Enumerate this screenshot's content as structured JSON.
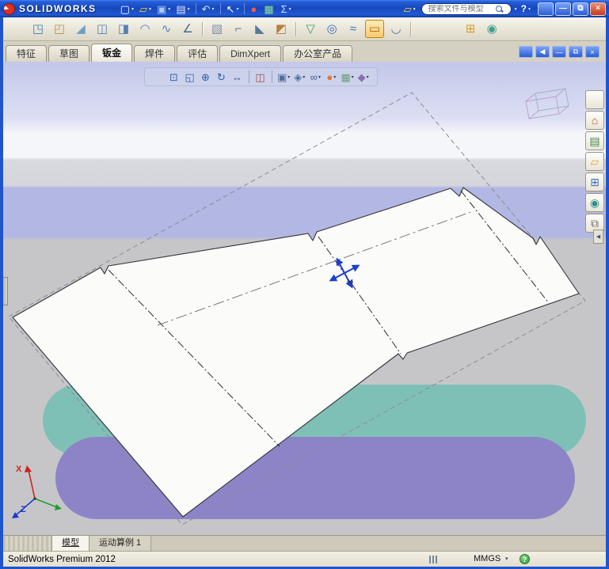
{
  "colors": {
    "frame_blue": "#1f55cc",
    "scene_teal": "#7fc0b6",
    "scene_purple": "#8d84c8",
    "highlight_orange": "#ffc96e"
  },
  "titlebar": {
    "app_name": "SOLIDWORKS",
    "search_placeholder": "搜索文件与模型",
    "search_arrow": "▾",
    "help": {
      "glyph": "?",
      "arrow": "▾"
    },
    "tools": [
      {
        "name": "new-document-button",
        "glyph": "▢",
        "color": "#ffffff",
        "arrow": "▾"
      },
      {
        "name": "open-document-button",
        "glyph": "▱",
        "color": "#ffd24a",
        "arrow": "▾"
      },
      {
        "name": "save-button",
        "glyph": "▣",
        "color": "#a8ccff",
        "arrow": "▾"
      },
      {
        "name": "print-button",
        "glyph": "▤",
        "color": "#dde6f8",
        "arrow": "▾"
      },
      {
        "sep": true
      },
      {
        "name": "undo-button",
        "glyph": "↶",
        "color": "#cfe2ff",
        "arrow": "▾"
      },
      {
        "sep": true
      },
      {
        "name": "select-button",
        "glyph": "↖",
        "color": "#ffffff",
        "arrow": "▾"
      },
      {
        "sep": true
      },
      {
        "name": "xpert-button",
        "glyph": "●",
        "color": "#ff5a4a",
        "arrow": ""
      },
      {
        "name": "measure-button",
        "glyph": "▦",
        "color": "#8fe08f",
        "arrow": ""
      },
      {
        "name": "equations-button",
        "glyph": "Σ",
        "color": "#cfe2ff",
        "arrow": "▾"
      }
    ],
    "search_tools": [
      {
        "name": "open-folder-button",
        "glyph": "▱",
        "color": "#ffd24a",
        "arrow": "▾"
      }
    ],
    "window_buttons": [
      {
        "name": "minimize-window-button",
        "glyph": "—"
      },
      {
        "name": "restore-window-button",
        "glyph": "⧉"
      },
      {
        "name": "close-window-button",
        "glyph": "×",
        "cls": "close"
      }
    ]
  },
  "sheetmetal_toolbar": [
    {
      "name": "base-flange-button",
      "glyph": "◳",
      "color": "#3f7fb8"
    },
    {
      "name": "convert-to-sheet-metal-button",
      "glyph": "◰",
      "color": "#b8913f"
    },
    {
      "name": "lofted-bend-button",
      "glyph": "◢",
      "color": "#6f9fc8"
    },
    {
      "name": "edge-flange-button",
      "glyph": "◫",
      "color": "#4f82b4"
    },
    {
      "name": "miter-flange-button",
      "glyph": "◨",
      "color": "#4f82b4"
    },
    {
      "name": "hem-button",
      "glyph": "◠",
      "color": "#4f82b4"
    },
    {
      "name": "jog-button",
      "glyph": "∿",
      "color": "#4f82b4"
    },
    {
      "name": "sketched-bend-button",
      "glyph": "∠",
      "color": "#48688c"
    },
    {
      "sep": true
    },
    {
      "name": "cross-break-button",
      "glyph": "▧",
      "color": "#7f8fa8"
    },
    {
      "name": "closed-corner-button",
      "glyph": "⌐",
      "color": "#56789a"
    },
    {
      "name": "welded-corner-button",
      "glyph": "◣",
      "color": "#56789a"
    },
    {
      "name": "forming-tool-button",
      "glyph": "◩",
      "color": "#b87f40"
    },
    {
      "sep": true
    },
    {
      "name": "extruded-cut-button",
      "glyph": "▽",
      "color": "#3f9f5f"
    },
    {
      "name": "simple-hole-button",
      "glyph": "◎",
      "color": "#3f6fbf"
    },
    {
      "name": "vent-button",
      "glyph": "≈",
      "color": "#3f6fbf"
    },
    {
      "name": "flatten-button",
      "glyph": "▭",
      "color": "#a06a10",
      "active": true
    },
    {
      "name": "no-bends-button",
      "glyph": "◡",
      "color": "#56789a"
    },
    {
      "sep": true,
      "gap": 60
    },
    {
      "name": "photoview-button",
      "glyph": "⊞",
      "color": "#d0a030"
    },
    {
      "name": "appearances-button",
      "glyph": "◉",
      "color": "#3f9f8f"
    }
  ],
  "command_tabs": [
    {
      "name": "tab-features",
      "label": "特征"
    },
    {
      "name": "tab-sketch",
      "label": "草图"
    },
    {
      "name": "tab-sheet-metal",
      "label": "钣金",
      "active": true
    },
    {
      "name": "tab-weldments",
      "label": "焊件"
    },
    {
      "name": "tab-evaluate",
      "label": "评估"
    },
    {
      "name": "tab-dimxpert",
      "label": "DimXpert"
    },
    {
      "name": "tab-office-products",
      "label": "办公室产品"
    }
  ],
  "tab_window_buttons": [
    {
      "name": "expand-featuremanager-button",
      "glyph": "◀"
    },
    {
      "name": "minimize-document-button",
      "glyph": "—"
    },
    {
      "name": "restore-document-button",
      "glyph": "⧉"
    },
    {
      "name": "close-document-button",
      "glyph": "×"
    }
  ],
  "view_toolbar": [
    {
      "name": "zoom-fit-button",
      "glyph": "⊡",
      "color": "#2f5fae",
      "arrow": ""
    },
    {
      "name": "zoom-area-button",
      "glyph": "◱",
      "color": "#2f5fae",
      "arrow": ""
    },
    {
      "name": "zoom-in-out-button",
      "glyph": "⊕",
      "color": "#2f5fae",
      "arrow": ""
    },
    {
      "name": "rotate-view-button",
      "glyph": "↻",
      "color": "#2f5fae",
      "arrow": ""
    },
    {
      "name": "pan-button",
      "glyph": "↔",
      "color": "#2f5fae",
      "arrow": ""
    },
    {
      "sep": true
    },
    {
      "name": "section-view-button",
      "glyph": "◫",
      "color": "#9a4f3f",
      "arrow": ""
    },
    {
      "sep": true
    },
    {
      "name": "view-orientation-button",
      "glyph": "▣",
      "color": "#4f6f9f",
      "arrow": "▾"
    },
    {
      "name": "display-style-button",
      "glyph": "◈",
      "color": "#4f6f9f",
      "arrow": "▾"
    },
    {
      "name": "hide-show-items-button",
      "glyph": "∞",
      "color": "#3f5f8f",
      "arrow": "▾"
    },
    {
      "name": "edit-appearance-button",
      "glyph": "●",
      "color": "#e07830",
      "arrow": "▾"
    },
    {
      "name": "apply-scene-button",
      "glyph": "▦",
      "color": "#6f9f7f",
      "arrow": "▾"
    },
    {
      "name": "view-settings-button",
      "glyph": "◆",
      "color": "#8f6fae",
      "arrow": "▾"
    }
  ],
  "taskpane": [
    {
      "name": "solidworks-resources-tab",
      "glyph": "⌂",
      "color": "#c05020"
    },
    {
      "name": "design-library-tab",
      "glyph": "▤",
      "color": "#3f8f4f"
    },
    {
      "name": "file-explorer-tab",
      "glyph": "▱",
      "color": "#d8a830"
    },
    {
      "name": "view-palette-tab",
      "glyph": "⊞",
      "color": "#3f6fbf"
    },
    {
      "name": "appearances-scenes-tab",
      "glyph": "◉",
      "color": "#2f8f8f"
    },
    {
      "name": "custom-properties-tab",
      "glyph": "⧉",
      "color": "#707070"
    }
  ],
  "taskpane_arrow": "◀",
  "viewport": {
    "triad": {
      "x_label": "X",
      "z_label": "Z"
    }
  },
  "sheet_tabs": [
    {
      "name": "tab-model",
      "label": "模型",
      "active": true
    },
    {
      "name": "tab-motion-study",
      "label": "运动算例 1"
    }
  ],
  "statusbar": {
    "left": "SolidWorks Premium 2012",
    "units": "MMGS",
    "units_arrow": "▾",
    "help_glyph": "?"
  }
}
